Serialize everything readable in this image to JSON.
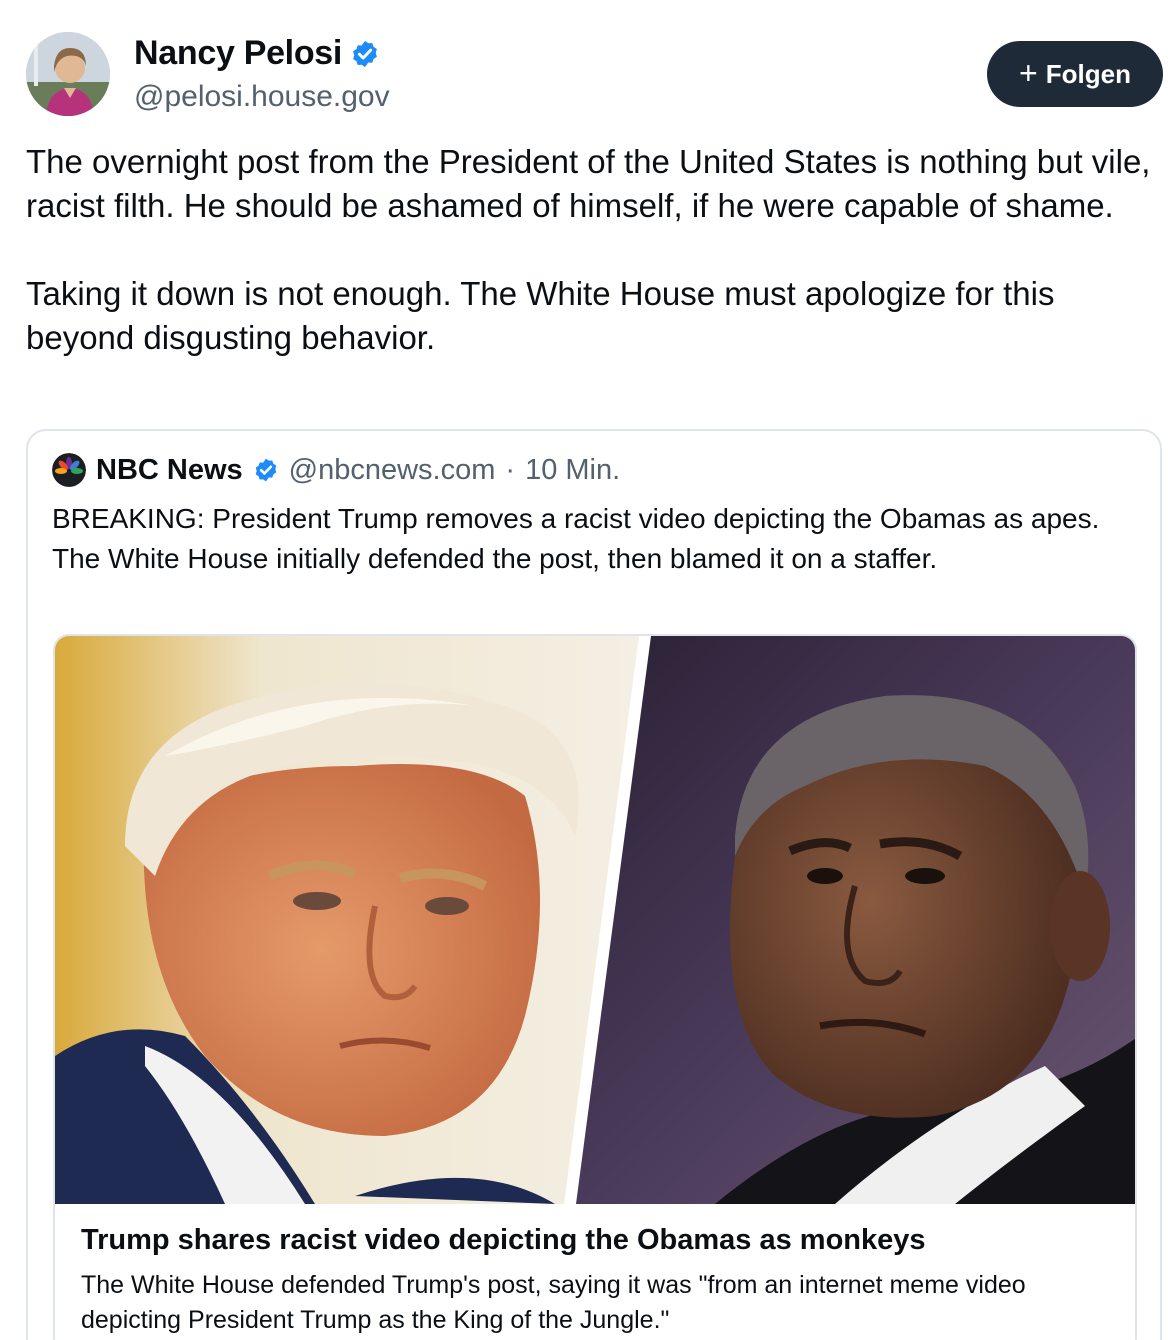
{
  "author": {
    "name": "Nancy Pelosi",
    "handle": "@pelosi.house.gov",
    "verified_icon": "verified-badge-icon",
    "avatar_icon": "avatar"
  },
  "follow_button": {
    "plus": "+",
    "label": "Folgen"
  },
  "post": {
    "paragraphs": [
      "The overnight post from the President of the United States is nothing but vile, racist filth. He should be ashamed of himself, if he were capable of shame.",
      "Taking it down is not enough. The White House must apologize for this beyond disgusting behavior."
    ]
  },
  "quote": {
    "name": "NBC News",
    "handle": "@nbcnews.com",
    "separator": "·",
    "time": "10 Min.",
    "text": "BREAKING: President Trump removes a racist video depicting the Obamas as apes. The White House initially defended the post, then blamed it on a staffer.",
    "link": {
      "title": "Trump shares racist video depicting the Obamas as monkeys",
      "description": "The White House defended Trump's post, saying it was \"from an internet meme video depicting President Trump as the King of the Jungle.\""
    }
  },
  "colors": {
    "verified": "#1d8cf8",
    "follow_bg": "#1e2a38",
    "muted_text": "#55606e",
    "border": "#dfe4ea"
  }
}
